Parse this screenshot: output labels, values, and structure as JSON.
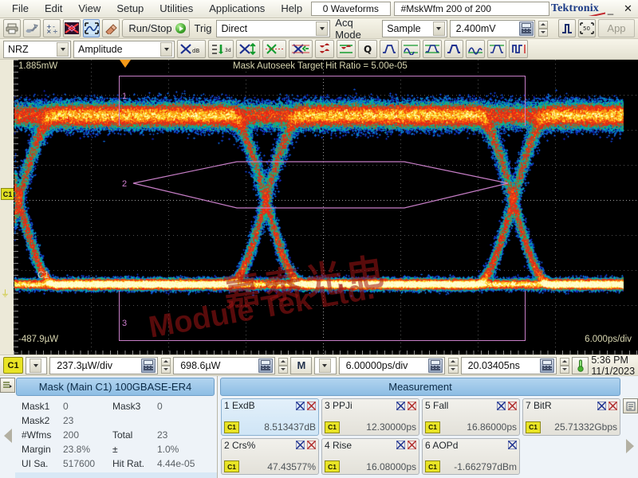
{
  "menubar": {
    "items": [
      {
        "label": "File"
      },
      {
        "label": "Edit"
      },
      {
        "label": "View"
      },
      {
        "label": "Setup"
      },
      {
        "label": "Utilities"
      },
      {
        "label": "Applications"
      },
      {
        "label": "Help"
      }
    ],
    "waveforms_field": "0 Waveforms",
    "mask_field": "#MskWfm  200 of 200",
    "brand": "Tektronix",
    "minimize_label": "_",
    "close_label": "✕"
  },
  "toolbar1": {
    "icons": [
      "print-icon",
      "save-icon",
      "math-icon",
      "mask-icon",
      "autoset-icon",
      "clear-icon"
    ],
    "run_stop_label": "Run/Stop",
    "trig_label": "Trig",
    "trig_value": "Direct",
    "acq_mode_label": "Acq Mode",
    "acq_mode_value": "Sample",
    "amplitude_value": "2.400mV",
    "app_label": "App"
  },
  "toolbar2": {
    "signal_type": "NRZ",
    "measure_type": "Amplitude",
    "icons": [
      "extinction-ratio-icon",
      "oma-icon",
      "eye-height-icon",
      "crossing-pct-icon",
      "eye-width-icon",
      "jitter-icon",
      "jitter-rms-icon",
      "q-factor-icon",
      "rise-time-icon",
      "fall-time-icon",
      "duty-cycle-icon",
      "pulse-width-icon",
      "overshoot-icon",
      "undershoot-icon",
      "bit-rate-icon"
    ]
  },
  "screen": {
    "top_left_value": "1.885mW",
    "bottom_left_value": "-487.9µW",
    "annotation": "Mask Autoseek Target Hit Ratio = 5.00e-05",
    "bottom_right_value": "6.000ps/div",
    "channel_label": "C1",
    "channel_marker": "C1",
    "mask_marker_1": "1",
    "mask_marker_2": "2",
    "mask_marker_3": "3",
    "watermark_cn": "嘉泰光电",
    "watermark_en": "Module Tek Ltd.",
    "colors": {
      "background": "#000000",
      "mask": "#c77ec7",
      "trigger": "#f59a19",
      "channel": "#dede22"
    }
  },
  "valuebar": {
    "channel": "C1",
    "vertical_scale": "237.3µW/div",
    "vertical_offset": "698.6µW",
    "timebase_mode": "M",
    "horizontal_scale": "6.00000ps/div",
    "horizontal_position": "20.03405ns",
    "clock": "5:36 PM 11/1/2023"
  },
  "mask_panel": {
    "title": "Mask (Main  C1) 100GBASE-ER4",
    "rows": [
      {
        "k1": "Mask1",
        "v1": "0",
        "k2": "Mask3",
        "v2": "0"
      },
      {
        "k1": "Mask2",
        "v1": "23",
        "k2": "",
        "v2": ""
      },
      {
        "k1": "#Wfms",
        "v1": "200",
        "k2": "Total",
        "v2": "23"
      },
      {
        "k1": "Margin",
        "v1": "23.8%",
        "k2": "±",
        "v2": "1.0%"
      },
      {
        "k1": "UI Sa.",
        "v1": "517600",
        "k2": "Hit Rat.",
        "v2": "4.44e-05"
      }
    ]
  },
  "measurement_panel": {
    "title": "Measurement",
    "items": [
      {
        "index": "1",
        "name": "ExdB",
        "source": "C1",
        "value": "8.513437dB",
        "highlight": true
      },
      {
        "index": "2",
        "name": "Crs%",
        "source": "C1",
        "value": "47.43577%",
        "highlight": false
      },
      {
        "index": "3",
        "name": "PPJi",
        "source": "C1",
        "value": "12.30000ps",
        "highlight": false
      },
      {
        "index": "4",
        "name": "Rise",
        "source": "C1",
        "value": "16.08000ps",
        "highlight": false
      },
      {
        "index": "5",
        "name": "Fall",
        "source": "C1",
        "value": "16.86000ps",
        "highlight": false
      },
      {
        "index": "6",
        "name": "AOPd",
        "source": "C1",
        "value": "-1.662797dBm",
        "highlight": false
      },
      {
        "index": "7",
        "name": "BitR",
        "source": "C1",
        "value": "25.71332Gbps",
        "highlight": false
      }
    ]
  }
}
